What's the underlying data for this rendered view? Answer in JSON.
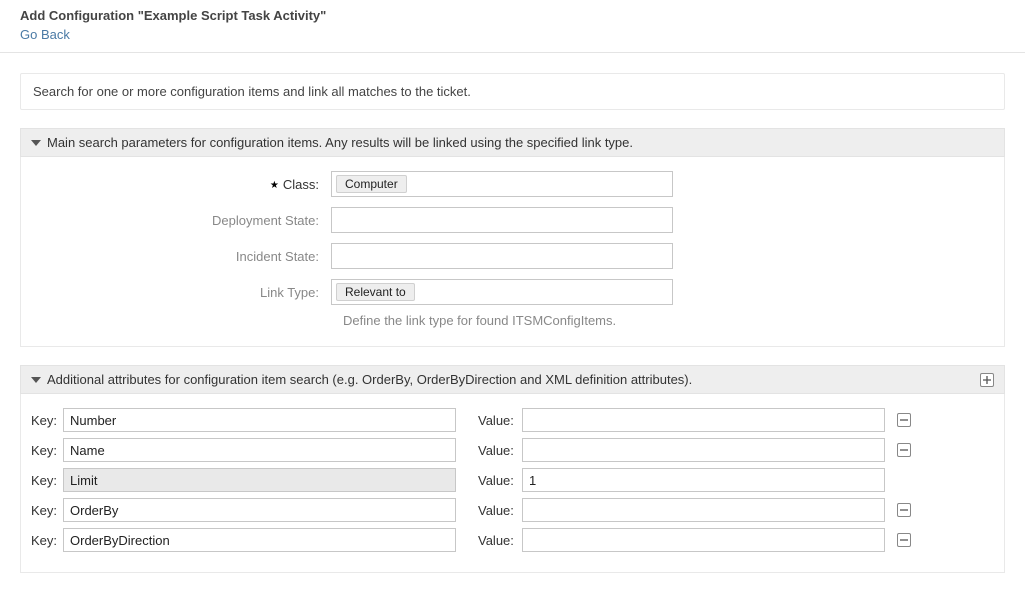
{
  "header": {
    "title": "Add Configuration \"Example Script Task Activity\"",
    "back_link": "Go Back"
  },
  "info_bar": "Search for one or more configuration items and link all matches to the ticket.",
  "sections": {
    "main": {
      "title": "Main search parameters for configuration items. Any results will be linked using the specified link type.",
      "fields": {
        "class_label": "Class:",
        "class_value": "Computer",
        "deployment_label": "Deployment State:",
        "deployment_value": "",
        "incident_label": "Incident State:",
        "incident_value": "",
        "linktype_label": "Link Type:",
        "linktype_value": "Relevant to",
        "linktype_help": "Define the link type for found ITSMConfigItems."
      },
      "required_marker": "★"
    },
    "attrs": {
      "title": "Additional attributes for configuration item search (e.g. OrderBy, OrderByDirection and XML definition attributes).",
      "key_label": "Key:",
      "value_label": "Value:",
      "rows": [
        {
          "key": "Number",
          "value": "",
          "removable": true,
          "locked": false
        },
        {
          "key": "Name",
          "value": "",
          "removable": true,
          "locked": false
        },
        {
          "key": "Limit",
          "value": "1",
          "removable": false,
          "locked": true
        },
        {
          "key": "OrderBy",
          "value": "",
          "removable": true,
          "locked": false
        },
        {
          "key": "OrderByDirection",
          "value": "",
          "removable": true,
          "locked": false
        }
      ]
    }
  }
}
